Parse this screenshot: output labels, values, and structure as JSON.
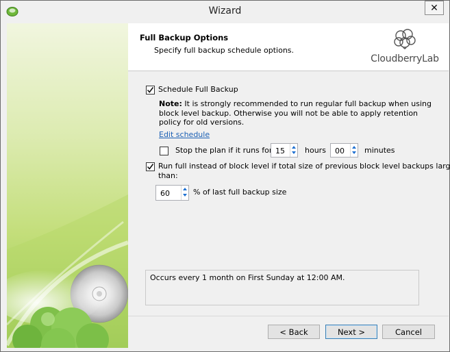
{
  "window": {
    "title": "Wizard",
    "close_glyph": "✕"
  },
  "header": {
    "title": "Full Backup Options",
    "subtitle": "Specify full backup schedule options.",
    "logo_text": "CloudberryLab"
  },
  "options": {
    "schedule_full_backup": {
      "label": "Schedule Full Backup",
      "checked": true
    },
    "note_prefix": "Note:",
    "note_text": " It is strongly recommended to run regular full backup when using block level backup. Otherwise you will not be able to apply retention policy for old versions.",
    "edit_schedule_link": "Edit schedule",
    "stop_plan": {
      "label": "Stop the plan if it runs for:",
      "checked": false,
      "hours_value": "15",
      "hours_label": "hours",
      "minutes_value": "00",
      "minutes_label": "minutes"
    },
    "run_full": {
      "label_line1": "Run full instead of block level if total size of previous block level backups larger",
      "label_line2": "than:",
      "checked": true,
      "percent_value": "60",
      "percent_label": "% of last full backup size"
    }
  },
  "summary": {
    "text": "Occurs every 1 month on First Sunday at 12:00 AM."
  },
  "buttons": {
    "back": "< Back",
    "next": "Next >",
    "cancel": "Cancel"
  },
  "colors": {
    "link": "#1a5fb4",
    "spin_arrow": "#1c6fd1",
    "panel_green": "#8fc24a"
  }
}
